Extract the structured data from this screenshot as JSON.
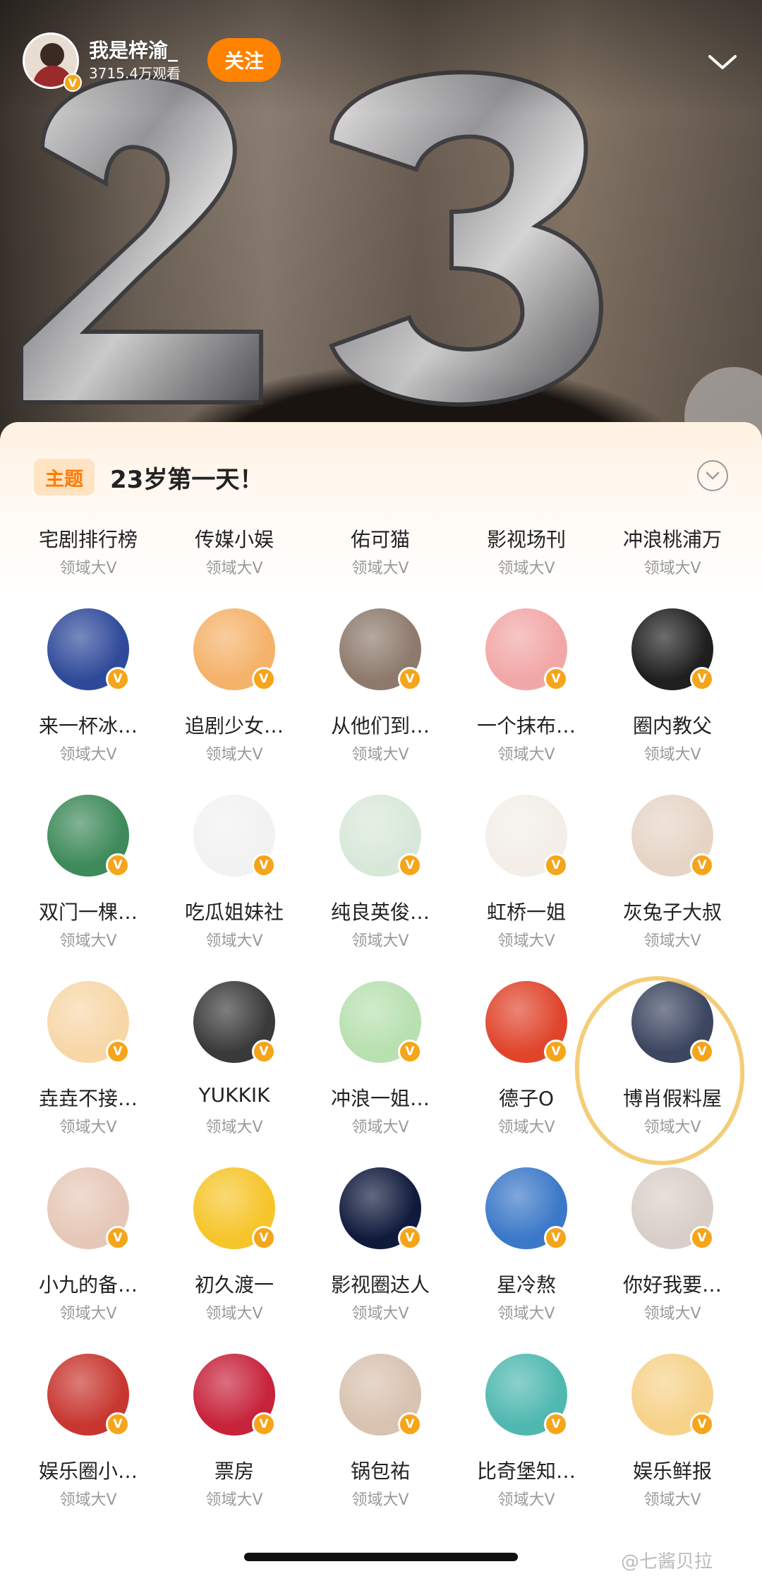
{
  "video": {
    "author_name": "我是梓渝_",
    "view_count": "3715.4万观看",
    "follow_label": "关注"
  },
  "topic": {
    "tag": "主题",
    "title": "23岁第一天！"
  },
  "accounts": [
    {
      "name": "宅剧排行榜",
      "tag": "领域大V",
      "color": "#f1e8c8"
    },
    {
      "name": "传媒小娱",
      "tag": "领域大V",
      "color": "#c8323a"
    },
    {
      "name": "佑可猫",
      "tag": "领域大V",
      "color": "#2a2a34"
    },
    {
      "name": "影视场刊",
      "tag": "领域大V",
      "color": "#5a5a5a"
    },
    {
      "name": "冲浪桃浦万",
      "tag": "领域大V",
      "color": "#f6c7d6"
    },
    {
      "name": "来一杯冰…",
      "tag": "领域大V",
      "color": "#2f4a9a"
    },
    {
      "name": "追剧少女…",
      "tag": "领域大V",
      "color": "#f5b26a"
    },
    {
      "name": "从他们到…",
      "tag": "领域大V",
      "color": "#8d7a6c"
    },
    {
      "name": "一个抹布…",
      "tag": "领域大V",
      "color": "#f2a7a7"
    },
    {
      "name": "圈内教父",
      "tag": "领域大V",
      "color": "#1f1f1f"
    },
    {
      "name": "双门一棵…",
      "tag": "领域大V",
      "color": "#3e8a5a"
    },
    {
      "name": "吃瓜姐妹社",
      "tag": "领域大V",
      "color": "#f2f2f2"
    },
    {
      "name": "纯良英俊…",
      "tag": "领域大V",
      "color": "#d8e8d8"
    },
    {
      "name": "虹桥一姐",
      "tag": "领域大V",
      "color": "#f3eee8"
    },
    {
      "name": "灰兔子大叔",
      "tag": "领域大V",
      "color": "#e6d5c6"
    },
    {
      "name": "垚垚不接…",
      "tag": "领域大V",
      "color": "#f7d7a8"
    },
    {
      "name": "YUKKIK",
      "tag": "领域大V",
      "color": "#3a3a3a"
    },
    {
      "name": "冲浪一姐…",
      "tag": "领域大V",
      "color": "#b8e0b0"
    },
    {
      "name": "德子O",
      "tag": "领域大V",
      "color": "#e0452c"
    },
    {
      "name": "博肖假料屋",
      "tag": "领域大V",
      "color": "#3c4660"
    },
    {
      "name": "小九的备…",
      "tag": "领域大V",
      "color": "#e6c8b8"
    },
    {
      "name": "初久渡一",
      "tag": "领域大V",
      "color": "#f6c52a"
    },
    {
      "name": "影视圈达人",
      "tag": "领域大V",
      "color": "#101a3c"
    },
    {
      "name": "星冷熬",
      "tag": "领域大V",
      "color": "#3b78c8"
    },
    {
      "name": "你好我要…",
      "tag": "领域大V",
      "color": "#d9cfc8"
    },
    {
      "name": "娱乐圈小…",
      "tag": "领域大V",
      "color": "#c8362f"
    },
    {
      "name": "票房",
      "tag": "领域大V",
      "color": "#c7233b"
    },
    {
      "name": "锅包祐",
      "tag": "领域大V",
      "color": "#d8c2b0"
    },
    {
      "name": "比奇堡知…",
      "tag": "领域大V",
      "color": "#4fb8b0"
    },
    {
      "name": "娱乐鲜报",
      "tag": "领域大V",
      "color": "#f6d28a"
    }
  ],
  "watermark": "@七酱贝拉"
}
